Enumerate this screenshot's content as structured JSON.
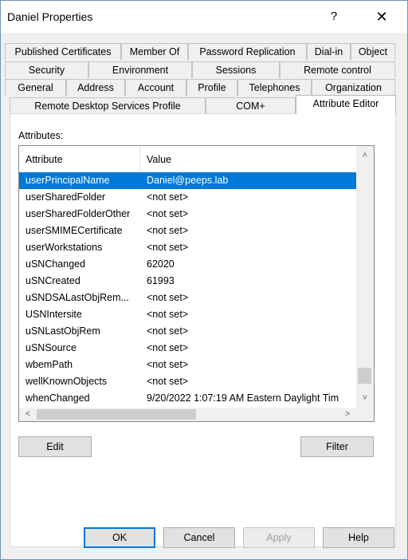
{
  "window": {
    "title": "Daniel Properties",
    "help_glyph": "?",
    "close_glyph": "✕"
  },
  "tabs": {
    "row1": [
      "Published Certificates",
      "Member Of",
      "Password Replication",
      "Dial-in",
      "Object"
    ],
    "row2": [
      "Security",
      "Environment",
      "Sessions",
      "Remote control"
    ],
    "row3": [
      "General",
      "Address",
      "Account",
      "Profile",
      "Telephones",
      "Organization"
    ],
    "row4": [
      "Remote Desktop Services Profile",
      "COM+",
      "Attribute Editor"
    ],
    "active": "Attribute Editor"
  },
  "attributes": {
    "label": "Attributes:",
    "columns": [
      "Attribute",
      "Value"
    ],
    "rows": [
      [
        "userPrincipalName",
        "Daniel@peeps.lab"
      ],
      [
        "userSharedFolder",
        "<not set>"
      ],
      [
        "userSharedFolderOther",
        "<not set>"
      ],
      [
        "userSMIMECertificate",
        "<not set>"
      ],
      [
        "userWorkstations",
        "<not set>"
      ],
      [
        "uSNChanged",
        "62020"
      ],
      [
        "uSNCreated",
        "61993"
      ],
      [
        "uSNDSALastObjRem...",
        "<not set>"
      ],
      [
        "USNIntersite",
        "<not set>"
      ],
      [
        "uSNLastObjRem",
        "<not set>"
      ],
      [
        "uSNSource",
        "<not set>"
      ],
      [
        "wbemPath",
        "<not set>"
      ],
      [
        "wellKnownObjects",
        "<not set>"
      ],
      [
        "whenChanged",
        "9/20/2022 1:07:19 AM Eastern Daylight Tim"
      ]
    ],
    "selected_row": 0
  },
  "buttons": {
    "edit": "Edit",
    "filter": "Filter",
    "ok": "OK",
    "cancel": "Cancel",
    "apply": "Apply",
    "help": "Help"
  },
  "colors": {
    "selection": "#0078d7",
    "dialog_bg": "#f0f0f0"
  }
}
